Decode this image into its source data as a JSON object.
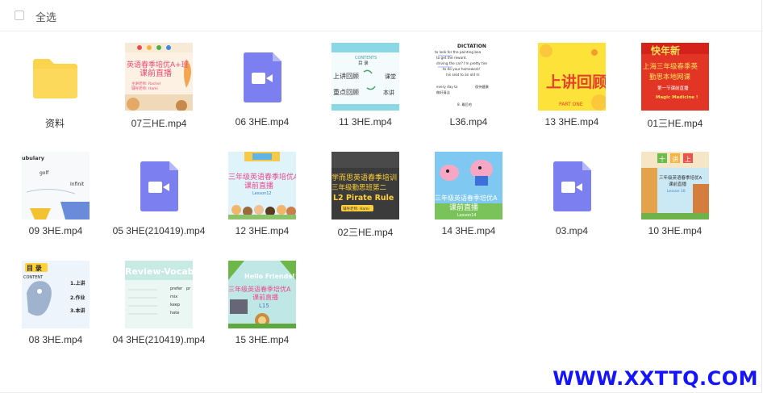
{
  "header": {
    "select_all_label": "全选"
  },
  "files": [
    {
      "name": "资料",
      "kind": "folder-icon"
    },
    {
      "name": "07三HE.mp4",
      "kind": "thumb-a",
      "lines": [
        "英语春季培优A+班",
        "课前直播",
        "主讲老师: Rachel",
        "辅导老师: Hami"
      ]
    },
    {
      "name": "06 3HE.mp4",
      "kind": "video-icon"
    },
    {
      "name": "11 3HE.mp4",
      "kind": "thumb-contents",
      "lines": [
        "CONTENTS",
        "目 录",
        "上讲回顾",
        "课堂",
        "重点回顾",
        "本讲"
      ]
    },
    {
      "name": "L36.mp4",
      "kind": "thumb-dictation",
      "lines": [
        "DICTATION",
        "to look for the painting bea",
        "to get the reward.",
        "driving the car? I'm pretty tire",
        "to do your homework!",
        "his seat to an old m",
        "every day to",
        "保持健康",
        "做好清洁",
        "8. 最后的"
      ]
    },
    {
      "name": "13 3HE.mp4",
      "kind": "thumb-review",
      "lines": [
        "上讲回顾",
        "PART ONE"
      ]
    },
    {
      "name": "01三HE.mp4",
      "kind": "thumb-newyear",
      "lines": [
        "快年新",
        "上海三年级春季英",
        "勤思本地网课",
        "第一节课前直播",
        "Magic Medicine !"
      ]
    },
    {
      "name": "09 3HE.mp4",
      "kind": "thumb-vocab",
      "lines": [
        "ubulary",
        "golf",
        "Infinit"
      ]
    },
    {
      "name": "05 3HE(210419).mp4",
      "kind": "video-icon"
    },
    {
      "name": "12 3HE.mp4",
      "kind": "thumb-school",
      "lines": [
        "三年级英语春季培优A",
        "课前直播",
        "Lesson12"
      ]
    },
    {
      "name": "02三HE.mp4",
      "kind": "thumb-pirate",
      "lines": [
        "学而思英语春季培训",
        "三年级勤思班第二",
        "L2 Pirate  Rule",
        "辅导老师: Hami"
      ]
    },
    {
      "name": "14 3HE.mp4",
      "kind": "thumb-peppa",
      "lines": [
        "三年级英语春季培优A",
        "课前直播",
        "Lesson14"
      ]
    },
    {
      "name": "03.mp4",
      "kind": "video-icon"
    },
    {
      "name": "10 3HE.mp4",
      "kind": "thumb-town",
      "lines": [
        "十",
        "讲",
        "上",
        "三年级英语春季培优A",
        "课前直播",
        "Lesson 10"
      ]
    },
    {
      "name": "08 3HE.mp4",
      "kind": "thumb-mulu",
      "lines": [
        "目 录",
        "CONTENT",
        "1.上讲",
        "2.作业",
        "3.本讲"
      ]
    },
    {
      "name": "04 3HE(210419).mp4",
      "kind": "thumb-review-vocab",
      "lines": [
        "Review-Vocabul",
        "prefer",
        "pr",
        "mix",
        "keep",
        "hate"
      ]
    },
    {
      "name": "15 3HE.mp4",
      "kind": "thumb-hello",
      "lines": [
        "Hello Friends!!",
        "三年级英语春季培优A",
        "课前直播",
        "L15"
      ]
    }
  ],
  "watermark": "WWW.XXTTQ.COM",
  "colors": {
    "folder": "#fcd34d",
    "video_doc": "#7b7ff0",
    "accent_blue": "#1414ff"
  }
}
